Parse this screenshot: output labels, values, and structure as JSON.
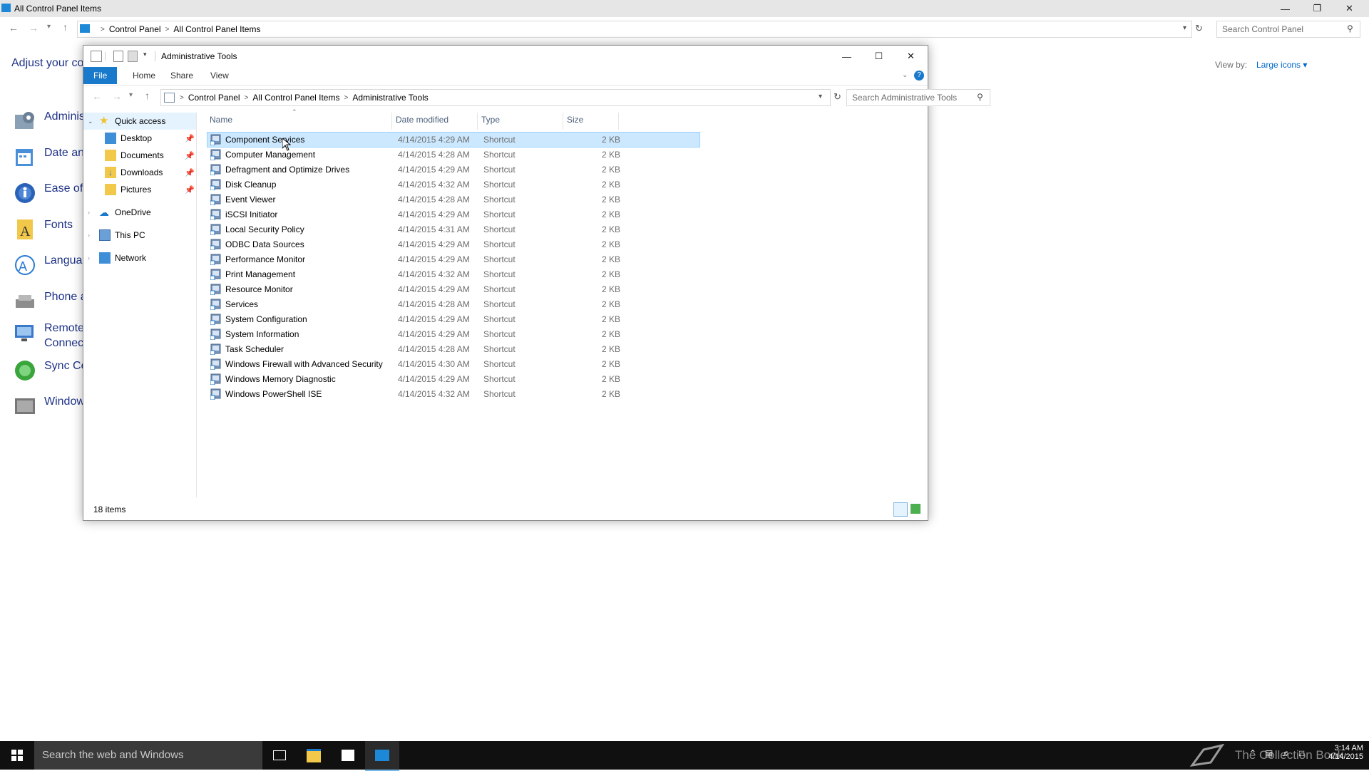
{
  "background_window": {
    "title": "All Control Panel Items",
    "breadcrumb": [
      "Control Panel",
      "All Control Panel Items"
    ],
    "search_placeholder": "Search Control Panel",
    "heading": "Adjust your co",
    "view_by_label": "View by:",
    "view_by_value": "Large icons",
    "items": [
      {
        "label": "Adminis",
        "icon": "administrative-tools-icon"
      },
      {
        "label": "Date an",
        "icon": "date-time-icon"
      },
      {
        "label": "Ease of",
        "icon": "ease-of-access-icon"
      },
      {
        "label": "Fonts",
        "icon": "fonts-icon"
      },
      {
        "label": "Languag",
        "icon": "language-icon"
      },
      {
        "label": "Phone a",
        "icon": "phone-modem-icon"
      },
      {
        "label": "Remote\nConnect",
        "icon": "remote-connections-icon"
      },
      {
        "label": "Sync Ce",
        "icon": "sync-center-icon"
      },
      {
        "label": "Window",
        "icon": "windows-icon"
      }
    ]
  },
  "explorer": {
    "title": "Administrative Tools",
    "ribbon_tabs": [
      "File",
      "Home",
      "Share",
      "View"
    ],
    "breadcrumb": [
      "Control Panel",
      "All Control Panel Items",
      "Administrative Tools"
    ],
    "search_placeholder": "Search Administrative Tools",
    "nav": {
      "quick_access": "Quick access",
      "pinned": [
        "Desktop",
        "Documents",
        "Downloads",
        "Pictures"
      ],
      "onedrive": "OneDrive",
      "this_pc": "This PC",
      "network": "Network"
    },
    "columns": [
      "Name",
      "Date modified",
      "Type",
      "Size"
    ],
    "files": [
      {
        "name": "Component Services",
        "date": "4/14/2015 4:29 AM",
        "type": "Shortcut",
        "size": "2 KB"
      },
      {
        "name": "Computer Management",
        "date": "4/14/2015 4:28 AM",
        "type": "Shortcut",
        "size": "2 KB"
      },
      {
        "name": "Defragment and Optimize Drives",
        "date": "4/14/2015 4:29 AM",
        "type": "Shortcut",
        "size": "2 KB"
      },
      {
        "name": "Disk Cleanup",
        "date": "4/14/2015 4:32 AM",
        "type": "Shortcut",
        "size": "2 KB"
      },
      {
        "name": "Event Viewer",
        "date": "4/14/2015 4:28 AM",
        "type": "Shortcut",
        "size": "2 KB"
      },
      {
        "name": "iSCSI Initiator",
        "date": "4/14/2015 4:29 AM",
        "type": "Shortcut",
        "size": "2 KB"
      },
      {
        "name": "Local Security Policy",
        "date": "4/14/2015 4:31 AM",
        "type": "Shortcut",
        "size": "2 KB"
      },
      {
        "name": "ODBC Data Sources",
        "date": "4/14/2015 4:29 AM",
        "type": "Shortcut",
        "size": "2 KB"
      },
      {
        "name": "Performance Monitor",
        "date": "4/14/2015 4:29 AM",
        "type": "Shortcut",
        "size": "2 KB"
      },
      {
        "name": "Print Management",
        "date": "4/14/2015 4:32 AM",
        "type": "Shortcut",
        "size": "2 KB"
      },
      {
        "name": "Resource Monitor",
        "date": "4/14/2015 4:29 AM",
        "type": "Shortcut",
        "size": "2 KB"
      },
      {
        "name": "Services",
        "date": "4/14/2015 4:28 AM",
        "type": "Shortcut",
        "size": "2 KB"
      },
      {
        "name": "System Configuration",
        "date": "4/14/2015 4:29 AM",
        "type": "Shortcut",
        "size": "2 KB"
      },
      {
        "name": "System Information",
        "date": "4/14/2015 4:29 AM",
        "type": "Shortcut",
        "size": "2 KB"
      },
      {
        "name": "Task Scheduler",
        "date": "4/14/2015 4:28 AM",
        "type": "Shortcut",
        "size": "2 KB"
      },
      {
        "name": "Windows Firewall with Advanced Security",
        "date": "4/14/2015 4:30 AM",
        "type": "Shortcut",
        "size": "2 KB"
      },
      {
        "name": "Windows Memory Diagnostic",
        "date": "4/14/2015 4:29 AM",
        "type": "Shortcut",
        "size": "2 KB"
      },
      {
        "name": "Windows PowerShell ISE",
        "date": "4/14/2015 4:32 AM",
        "type": "Shortcut",
        "size": "2 KB"
      }
    ],
    "selected_index": 0,
    "status": "18 items"
  },
  "taskbar": {
    "search_placeholder": "Search the web and Windows",
    "watermark": "The Collection Book",
    "time": "3:14 AM",
    "date": "4/14/2015"
  },
  "colors": {
    "accent": "#1979ca",
    "selection": "#cce8ff",
    "link": "#1e3287",
    "taskbar": "#101010"
  }
}
